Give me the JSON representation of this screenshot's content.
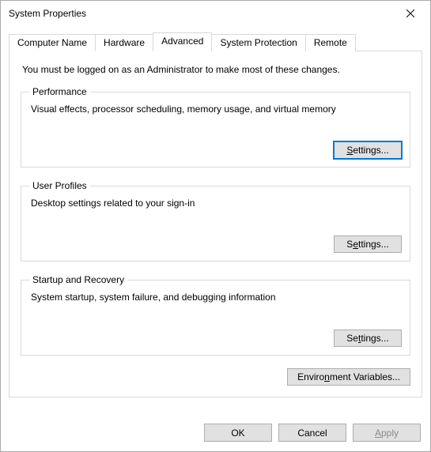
{
  "window": {
    "title": "System Properties"
  },
  "tabs": {
    "computer_name": "Computer Name",
    "hardware": "Hardware",
    "advanced": "Advanced",
    "system_protection": "System Protection",
    "remote": "Remote"
  },
  "advanced": {
    "intro": "You must be logged on as an Administrator to make most of these changes.",
    "performance": {
      "legend": "Performance",
      "desc": "Visual effects, processor scheduling, memory usage, and virtual memory",
      "settings_prefix": "S",
      "settings_suffix": "ettings..."
    },
    "user_profiles": {
      "legend": "User Profiles",
      "desc": "Desktop settings related to your sign-in",
      "settings_prefix": "S",
      "settings_suffix": "ettings..."
    },
    "startup_recovery": {
      "legend": "Startup and Recovery",
      "desc": "System startup, system failure, and debugging information",
      "settings_prefix": "S",
      "settings_suffix": "ettings..."
    },
    "env_prefix": "Enviro",
    "env_u": "n",
    "env_suffix": "ment Variables..."
  },
  "footer": {
    "ok": "OK",
    "cancel": "Cancel",
    "apply_u": "A",
    "apply_suffix": "pply"
  }
}
